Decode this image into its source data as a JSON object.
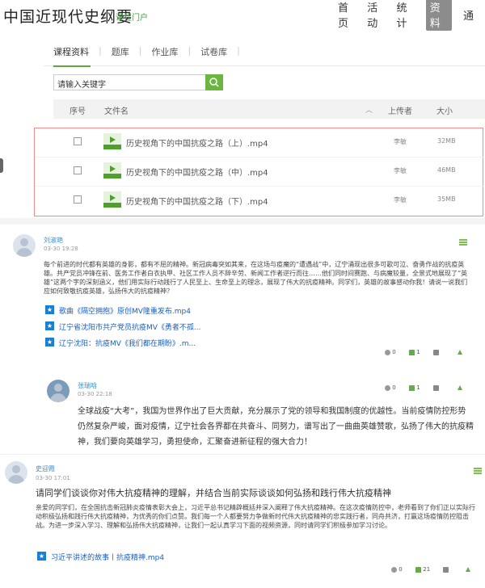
{
  "header": {
    "title": "中国近现代史纲要",
    "subtitle": "课程门户",
    "nav": [
      "首页",
      "活动",
      "统计",
      "资料",
      "通"
    ],
    "active_nav": "资料"
  },
  "tabs": [
    "课程资料",
    "题库",
    "作业库",
    "试卷库"
  ],
  "search": {
    "placeholder": "请输入关键字"
  },
  "table": {
    "headers": {
      "index": "序号",
      "name": "文件名",
      "uploader": "上传者",
      "size": "大小"
    },
    "rows": [
      {
        "name": "历史视角下的中国抗疫之路（上）.mp4",
        "uploader": "李敏",
        "size": "32MB"
      },
      {
        "name": "历史视角下的中国抗疫之路（中）.mp4",
        "uploader": "李敏",
        "size": "46MB"
      },
      {
        "name": "历史视角下的中国抗疫之路（下）.mp4",
        "uploader": "李敏",
        "size": "35MB"
      }
    ]
  },
  "posts": [
    {
      "author": "刘淑艳",
      "time": "03-30 19:28",
      "text": "每个前进的时代都有英雄的身影，都有不屈的精神。新冠病毒突如其来，在这场与疫魔的“遭遇战”中，辽宁涌现出很多可歌可泣、奋勇作战的抗疫英雄。共产党员冲锋在前、医务工作者白衣执甲、社区工作人员不辞辛劳、新闻工作者逆行而往……他们同时间赛跑、与病魔较量，全景式地展现了“英雄”这两个字的深刻涵义，他们用实际行动践行了人民至上、生命至上的理念，展现了伟大的抗疫精神。同学们，英雄的故事感动你我！请说一说我们应如何致敬抗疫英雄，弘扬伟大的抗疫精神？",
      "links": [
        "歌曲《隔空拥抱》原创MV隆重发布.mp4",
        "辽宁省沈阳市共产党员抗疫MV《勇者不孤...",
        "辽宁沈阳：抗疫MV《我们都在期盼》.m..."
      ],
      "views": "0",
      "likes": "1"
    },
    {
      "author": "张瑞晗",
      "time": "03-30 22:18",
      "text": "全球战疫“大考”，我国为世界作出了巨大贡献，充分展示了党的领导和我国制度的优越性。当前疫情防控形势仍然复杂严峻，面对疫情，辽宁社会各界都在共奋斗、同努力，谱写出了一曲曲英雄赞歌，弘扬了伟大的抗疫精神，我们要向英雄学习，勇担使命，汇聚奋进新征程的强大合力！",
      "views": "0",
      "likes": "1"
    },
    {
      "author": "史迎霞",
      "time": "03-30 17:01",
      "title": "请同学们谈谈你对伟大抗疫精神的理解，并结合当前实际谈谈如何弘扬和践行伟大抗疫精神",
      "text": "亲爱的同学们，在全国抗击新冠肺炎疫情表彰大会上，习近平总书记精辟概括并深入阐释了伟大抗疫精神。在这次疫情防控中，老师看到了你们正以实际行动积极弘扬和践行伟大抗疫精神，为优秀的你们点赞。我们每一个人都要努力争做新时代伟大抗疫精神的忠实践行者，同舟共济，打赢这场疫情防控阻击战。为进一步深入学习、理解和弘扬伟大抗疫精神，让我们一起认真学习下面的视频资源，同时请同学们积极参加学习讨论。",
      "links": [
        "习近平讲述的故事丨抗疫精神.mp4"
      ],
      "views": "0",
      "likes": "21"
    }
  ]
}
